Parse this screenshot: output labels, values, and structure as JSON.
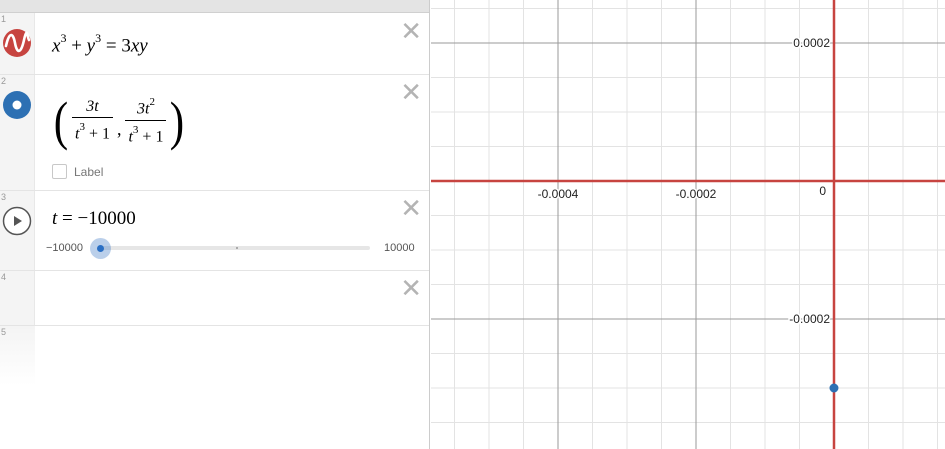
{
  "expressions": [
    {
      "index": "1",
      "icon": "implicit-curve-icon",
      "color": "#c74440",
      "latex": {
        "lhs_a": "x",
        "exp_a": "3",
        "op": "+",
        "lhs_b": "y",
        "exp_b": "3",
        "eq": "=",
        "rhs_coef": "3",
        "rhs_vars": "xy"
      }
    },
    {
      "index": "2",
      "icon": "point-icon",
      "color": "#2d70b3",
      "latex": {
        "left_paren": "(",
        "frac1_num": "3t",
        "frac1_den_base": "t",
        "frac1_den_exp": "3",
        "frac1_den_rest": " + 1",
        "comma": ",",
        "frac2_num_base": "3t",
        "frac2_num_exp": "2",
        "frac2_den_base": "t",
        "frac2_den_exp": "3",
        "frac2_den_rest": " + 1",
        "right_paren": ")"
      },
      "label_checkbox": "Label"
    },
    {
      "index": "3",
      "icon": "play-icon",
      "latex": {
        "var": "t",
        "eq": "=",
        "value": "−10000"
      },
      "slider": {
        "min": "−10000",
        "max": "10000",
        "value": -10000
      }
    },
    {
      "index": "4"
    },
    {
      "index": "5"
    }
  ],
  "graph": {
    "x_ticks": [
      {
        "v": -0.0004,
        "label": "-0.0004"
      },
      {
        "v": -0.0002,
        "label": "-0.0002"
      }
    ],
    "y_ticks": [
      {
        "v": 0.0002,
        "label": "0.0002"
      },
      {
        "v": -0.0002,
        "label": "-0.0002"
      }
    ],
    "origin_label": "0",
    "curve_color": "#c74440",
    "point_color": "#2d70b3",
    "point": {
      "t": -10000,
      "x": -3e-08,
      "y": -0.0003
    }
  }
}
